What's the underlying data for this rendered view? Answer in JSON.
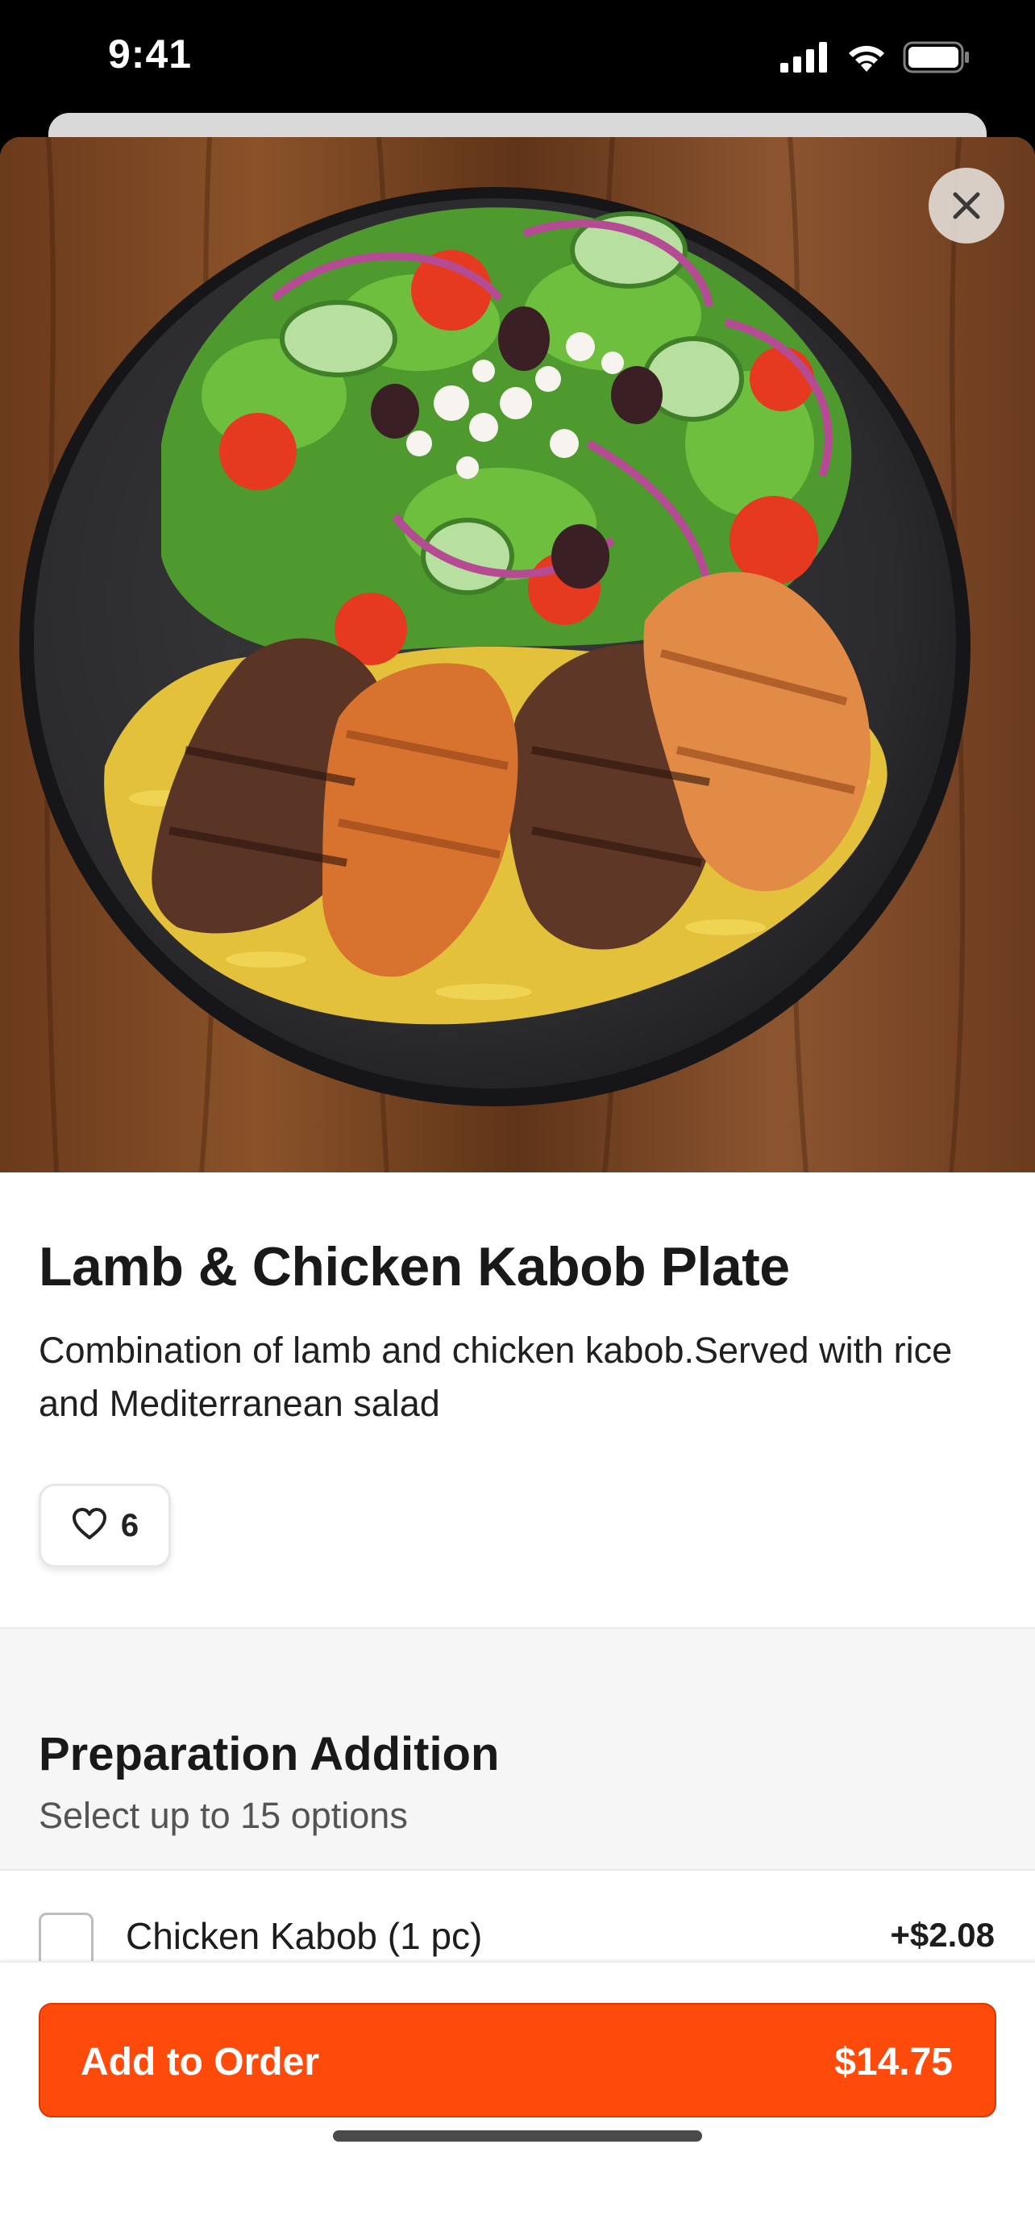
{
  "status_bar": {
    "time": "9:41"
  },
  "item": {
    "title": "Lamb & Chicken Kabob Plate",
    "description": "Combination of lamb and chicken kabob.Served with rice and Mediterranean salad",
    "like_count": "6"
  },
  "options_group": {
    "title": "Preparation Addition",
    "subtitle": "Select up to 15 options",
    "options": [
      {
        "label": "Chicken Kabob (1 pc)",
        "price": "+$2.08",
        "checked": false
      }
    ]
  },
  "footer": {
    "add_label": "Add to Order",
    "total": "$14.75"
  },
  "icons": {
    "close": "close-icon",
    "heart": "heart-outline-icon",
    "signal": "cellular-signal-icon",
    "wifi": "wifi-icon",
    "battery": "battery-icon"
  },
  "colors": {
    "accent": "#fe4a0b"
  }
}
